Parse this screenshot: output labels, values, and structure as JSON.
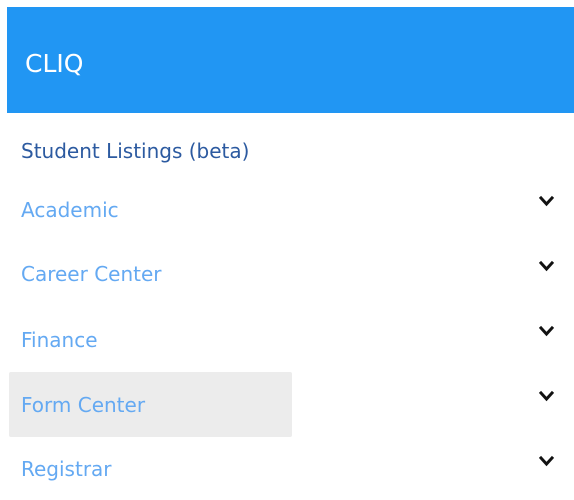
{
  "app": {
    "title": "CLIQ",
    "header_color": "#2196f3"
  },
  "nav": {
    "items": [
      {
        "label": "Student Listings (beta)",
        "has_submenu": false,
        "highlighted": false
      },
      {
        "label": "Academic",
        "has_submenu": true,
        "icon": "chevron-down-icon",
        "highlighted": false
      },
      {
        "label": "Career Center",
        "has_submenu": true,
        "icon": "chevron-down-icon",
        "highlighted": false
      },
      {
        "label": "Finance",
        "has_submenu": true,
        "icon": "chevron-down-icon",
        "highlighted": false
      },
      {
        "label": "Form Center",
        "has_submenu": true,
        "icon": "chevron-down-icon",
        "highlighted": true
      },
      {
        "label": "Registrar",
        "has_submenu": true,
        "icon": "chevron-down-icon",
        "highlighted": false
      }
    ],
    "link_color": "#64a9f2",
    "primary_link_color": "#2c5aa0",
    "highlight_color": "#ececec"
  }
}
